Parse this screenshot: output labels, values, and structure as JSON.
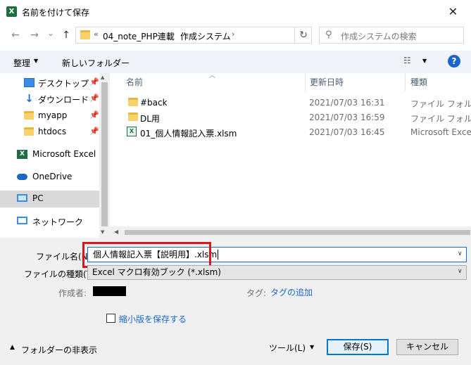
{
  "window": {
    "title": "名前を付けて保存",
    "app_icon": "X",
    "close_glyph": "✕"
  },
  "nav": {
    "back": "←",
    "forward": "→",
    "dropdown": "⌄",
    "up": "↑"
  },
  "address": {
    "overflow": "«",
    "crumbs": [
      "04_note_PHP連載",
      "作成システム"
    ],
    "sep": "›"
  },
  "search": {
    "placeholder": "作成システムの検索"
  },
  "toolbar": {
    "organize": "整理",
    "new_folder": "新しいフォルダー"
  },
  "sidebar": {
    "items": [
      {
        "label": "デスクトップ",
        "icon": "desktop-icon",
        "pinned": true
      },
      {
        "label": "ダウンロード",
        "icon": "download-icon",
        "pinned": true
      },
      {
        "label": "myapp",
        "icon": "folder-icon",
        "pinned": true
      },
      {
        "label": "htdocs",
        "icon": "folder-icon",
        "pinned": true
      },
      {
        "label": "Microsoft Excel",
        "icon": "excel-icon",
        "pinned": false
      },
      {
        "label": "OneDrive",
        "icon": "cloud-icon",
        "pinned": false
      },
      {
        "label": "PC",
        "icon": "pc-icon",
        "pinned": false
      },
      {
        "label": "ネットワーク",
        "icon": "network-icon",
        "pinned": false
      }
    ]
  },
  "columns": {
    "name": "名前",
    "date": "更新日時",
    "type": "種類"
  },
  "files": [
    {
      "name": "#back",
      "date": "2021/07/03 16:31",
      "type": "ファイル フォルダー",
      "icon": "folder-icon"
    },
    {
      "name": "DL用",
      "date": "2021/07/03 16:59",
      "type": "ファイル フォルダー",
      "icon": "folder-icon"
    },
    {
      "name": "01_個人情報記入票.xlsm",
      "date": "2021/07/03 16:45",
      "type": "Microsoft Excel",
      "icon": "excel-file-icon"
    }
  ],
  "form": {
    "filename_label": "ファイル名(N):",
    "filename_value": "個人情報記入票【説明用】.xlsm",
    "filetype_label": "ファイルの種類(T):",
    "filetype_value": "Excel マクロ有効ブック (*.xlsm)",
    "author_label": "作成者:",
    "tags_label": "タグ:",
    "tags_link": "タグの追加",
    "thumbnail_label": "縮小版を保存する",
    "hide_folders": "フォルダーの非表示",
    "tools": "ツール(L)",
    "save": "保存(S)",
    "cancel": "キャンセル"
  },
  "colors": {
    "accent": "#1a66c9",
    "highlight": "#e0141e",
    "excel": "#1d6f42"
  }
}
